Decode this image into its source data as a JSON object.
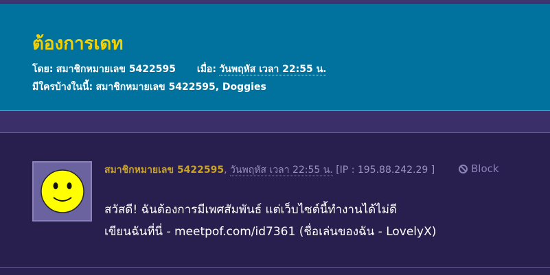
{
  "topic": {
    "title": "ต้องการเดท",
    "by_label": "โดย:",
    "by_value": "สมาชิกหมายเลข 5422595",
    "when_label": "เมื่อ:",
    "when_value": "วันพฤหัส เวลา 22:55 น.",
    "present_label": "มีใครบ้างในนี้:",
    "present_value": "สมาชิกหมายเลข 5422595, Doggies"
  },
  "post": {
    "author": "สมาชิกหมายเลข 5422595",
    "separator": ",",
    "date": "วันพฤหัส เวลา 22:55 น.",
    "ip": "[IP : 195.88.242.29 ]",
    "block_label": "Block",
    "avatar_icon": "smiley-face-icon",
    "body_line1": "สวัสดี! ฉันต้องการมีเพศสัมพันธ์ แต่เว็บไซต์นี้ทำงานได้ไม่ดี",
    "body_line2": "เขียนฉันที่นี่ - meetpof.com/id7361 (ชื่อเล่นของฉัน - LovelyX)"
  },
  "colors": {
    "header_bg": "#00729d",
    "title": "#f5d000",
    "page_bg": "#2a2150",
    "author": "#c9a227"
  }
}
